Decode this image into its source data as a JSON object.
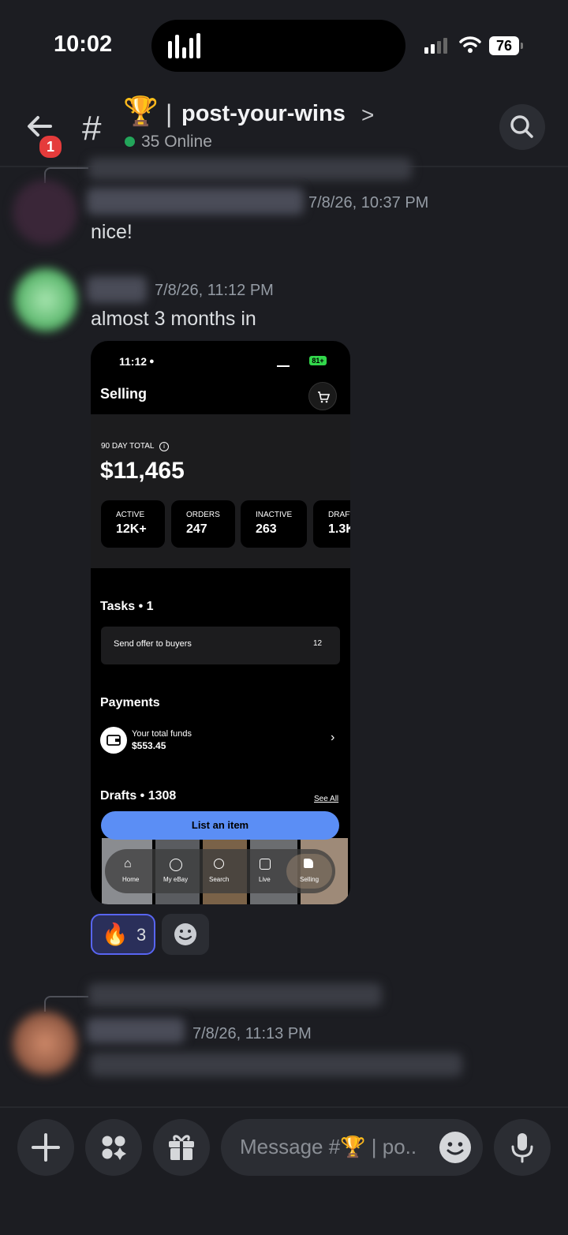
{
  "status_bar": {
    "time": "10:02",
    "battery": "76"
  },
  "header": {
    "back_badge": "1",
    "channel_hash": "#",
    "channel_emoji": "🏆",
    "channel_separator": "|",
    "channel_name": "post-your-wins",
    "chevron": ">",
    "online_text": "35 Online"
  },
  "messages": [
    {
      "timestamp": "7/8/26, 10:37 PM",
      "text": "nice!"
    },
    {
      "timestamp": "7/8/26, 11:12 PM",
      "text": "almost 3 months in"
    },
    {
      "timestamp": "7/8/26, 11:13 PM",
      "text": ""
    }
  ],
  "attachment": {
    "time": "11:12",
    "battery": "81+",
    "title": "Selling",
    "total_label": "90 DAY TOTAL",
    "total_value": "$11,465",
    "stats": [
      {
        "label": "ACTIVE",
        "value": "12K+"
      },
      {
        "label": "ORDERS",
        "value": "247"
      },
      {
        "label": "INACTIVE",
        "value": "263"
      },
      {
        "label": "DRAFT",
        "value": "1.3K"
      }
    ],
    "tasks_title": "Tasks • 1",
    "task_text": "Send offer to buyers",
    "task_count": "12",
    "payments_title": "Payments",
    "funds_label": "Your total funds",
    "funds_value": "$553.45",
    "drafts_title": "Drafts • 1308",
    "see_all": "See All",
    "list_button": "List an item",
    "nav": [
      "Home",
      "My eBay",
      "Search",
      "Live",
      "Selling"
    ]
  },
  "reaction": {
    "emoji": "🔥",
    "count": "3"
  },
  "composer": {
    "placeholder": "Message #🏆 | po.."
  },
  "colors": {
    "accent": "#5865f2",
    "online": "#23a55a",
    "badge": "#e53b3b",
    "ebay_button": "#5b8ef5"
  }
}
